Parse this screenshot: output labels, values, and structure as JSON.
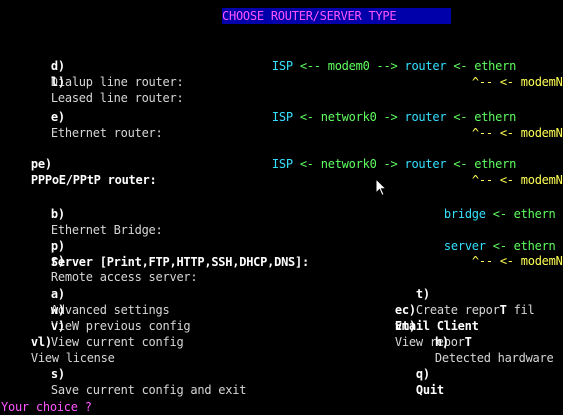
{
  "title": "CHOOSE ROUTER/SERVER TYPE",
  "rows": {
    "dialup": {
      "key": "d)",
      "label": "Dialup line router:",
      "diagram": {
        "isp": "ISP",
        "link": "<-- modem0 -->",
        "router": "router",
        "tail": "<- ethern"
      }
    },
    "leased": {
      "key": "l)",
      "label": "Leased line router:",
      "diagram": {
        "caret": "^--",
        "tail": "<- modemN"
      }
    },
    "ethernet": {
      "key": "e)",
      "label": "Ethernet router:",
      "diagram": {
        "isp": "ISP",
        "link": "<- network0 ->",
        "router": "router",
        "tail": "<- ethern",
        "caret": "^--",
        "tail2": "<- modemN"
      }
    },
    "pppoe": {
      "key": "pe)",
      "label": "PPPoE/PPtP router:",
      "diagram": {
        "isp": "ISP",
        "link": "<- network0 ->",
        "router": "router",
        "tail": "<- ethern",
        "caret": "^--",
        "tail2": "<- modemN"
      }
    },
    "bridge": {
      "key": "b)",
      "label": "Ethernet Bridge:",
      "diagram": {
        "bridge": "bridge",
        "tail": "<- ethern"
      }
    },
    "server": {
      "key": "p)",
      "label": "Server [Print,FTP,HTTP,SSH,DHCP,DNS]:",
      "diagram": {
        "server": "server",
        "tail": "<- ethern"
      }
    },
    "remote": {
      "key": "r)",
      "label": "Remote access server:",
      "diagram": {
        "caret": "^--",
        "tail": "<- modemN"
      }
    }
  },
  "menu": {
    "advanced": {
      "key": "a)",
      "label": "Advanced settings"
    },
    "report": {
      "key": "t)",
      "label_a": "Create repor",
      "label_hot": "T",
      "label_b": " fil"
    },
    "view_prev": {
      "key": "w)",
      "label": "VieW previous config"
    },
    "email": {
      "key": "ec)",
      "label": "Email Client"
    },
    "view_cur": {
      "key": "v)",
      "label": "View current config"
    },
    "view_report": {
      "key": "vt)",
      "label_a": "View repor",
      "label_hot": "T"
    },
    "license": {
      "key": "vl)",
      "label": "View license"
    },
    "hardware": {
      "key": "h)",
      "label": "Detected hardware"
    },
    "save": {
      "key": "s)",
      "label": "Save current config and exit"
    },
    "quit": {
      "key": "q)",
      "label": "Quit"
    }
  },
  "prompt": "Your choice ?",
  "colors": {
    "background": "#000000",
    "title_bg": "#0000aa",
    "title_fg": "#ff55ff",
    "isp": "#35e0ff",
    "link": "#5fff5f",
    "modem": "#ffff55",
    "prompt": "#ff55ff"
  }
}
